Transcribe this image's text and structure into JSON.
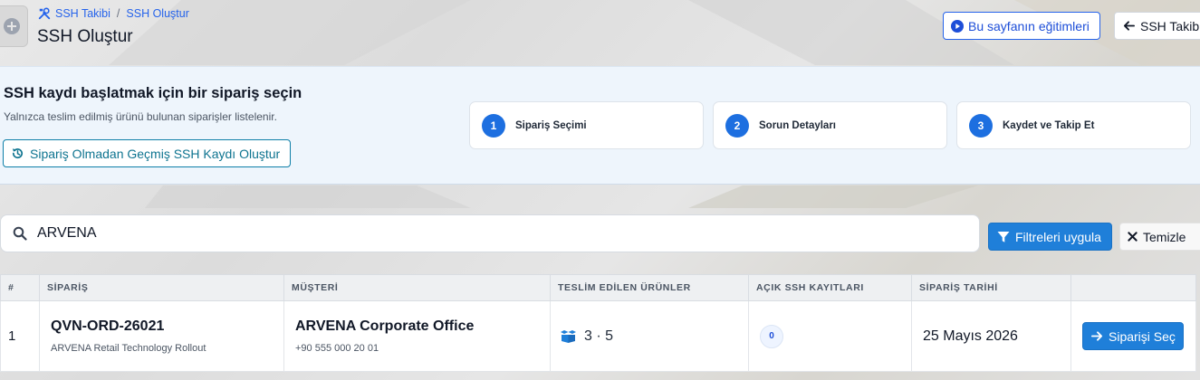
{
  "header": {
    "breadcrumb": [
      {
        "label": "SSH Takibi",
        "icon": "tools-icon"
      },
      {
        "label": "SSH Oluştur"
      }
    ],
    "breadcrumb_separator": "/",
    "title": "SSH Oluştur",
    "training_button": "Bu sayfanın eğitimleri",
    "back_button": "SSH Takibi"
  },
  "intro": {
    "title": "SSH kaydı başlatmak için bir sipariş seçin",
    "subtitle": "Yalnızca teslim edilmiş ürünü bulunan siparişler listelenir.",
    "history_button": "Sipariş Olmadan Geçmiş SSH Kaydı Oluştur",
    "steps": [
      {
        "number": "1",
        "label": "Sipariş Seçimi"
      },
      {
        "number": "2",
        "label": "Sorun Detayları"
      },
      {
        "number": "3",
        "label": "Kaydet ve Takip Et"
      }
    ]
  },
  "filters": {
    "search_value": "ARVENA",
    "apply_button": "Filtreleri uygula",
    "clear_button": "Temizle"
  },
  "table": {
    "columns": [
      "#",
      "SİPARİŞ",
      "MÜŞTERİ",
      "TESLİM EDİLEN ÜRÜNLER",
      "AÇIK SSH KAYITLARI",
      "SİPARİŞ TARİHİ",
      ""
    ],
    "rows": [
      {
        "index": "1",
        "order_code": "QVN-ORD-26021",
        "order_name": "ARVENA Retail Technology Rollout",
        "customer_name": "ARVENA Corporate Office",
        "customer_phone": "+90 555 000 20 01",
        "delivered": "3 · 5",
        "open_ssh": "0",
        "order_date": "25 Mayıs 2026",
        "select_button": "Siparişi Seç"
      }
    ]
  },
  "colors": {
    "primary": "#1f7fd9",
    "link": "#2563eb",
    "history": "#0e7490",
    "panel_bg": "#eef5fc"
  }
}
